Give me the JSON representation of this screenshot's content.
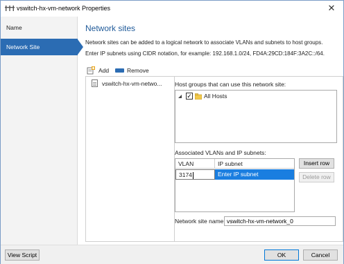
{
  "window": {
    "title": "vswitch-hx-vm-network Properties",
    "close_glyph": "✕"
  },
  "sidebar": {
    "items": [
      {
        "label": "Name",
        "selected": false
      },
      {
        "label": "Network Site",
        "selected": true
      }
    ]
  },
  "main": {
    "section_title": "Network sites",
    "description": "Network sites can be added to a logical network to associate VLANs and subnets to host groups.",
    "cidr_hint": "Enter IP subnets using CIDR notation, for example: 192.168.1.0/24, FD4A:29CD:184F:3A2C::/64.",
    "toolbar": {
      "add_label": "Add",
      "remove_label": "Remove"
    },
    "sites": [
      {
        "label": "vswitch-hx-vm-netwo..."
      }
    ],
    "host_groups": {
      "label": "Host groups that can use this network site:",
      "items": [
        {
          "label": "All Hosts",
          "checked": true
        }
      ]
    },
    "vlans": {
      "label": "Associated VLANs and IP subnets:",
      "headers": {
        "vlan": "VLAN",
        "subnet": "IP subnet"
      },
      "rows": [
        {
          "vlan": "3174",
          "subnet": "Enter IP subnet"
        }
      ],
      "insert_label": "Insert row",
      "delete_label": "Delete row"
    },
    "site_name": {
      "label": "Network site name:",
      "value": "vswitch-hx-vm-network_0"
    }
  },
  "footer": {
    "view_script_label": "View Script",
    "ok_label": "OK",
    "cancel_label": "Cancel"
  },
  "colors": {
    "accent": "#2b6cb3",
    "selection": "#1a7ee0",
    "title_blue": "#1f5a99"
  }
}
